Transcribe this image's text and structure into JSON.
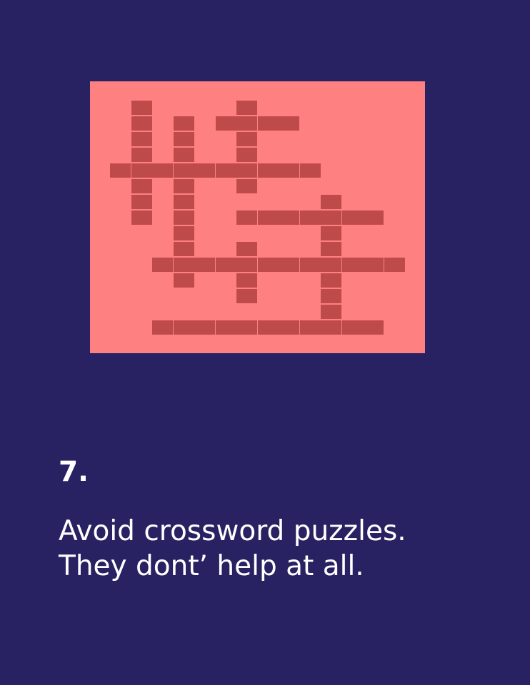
{
  "slide": {
    "number": "7.",
    "caption_lines": [
      "Avoid crossword puzzles.",
      "They dont’ help at all."
    ]
  },
  "colors": {
    "background": "#282262",
    "panel": "#ff8080",
    "cell": "#bf4a4a",
    "text": "#ffffff"
  }
}
